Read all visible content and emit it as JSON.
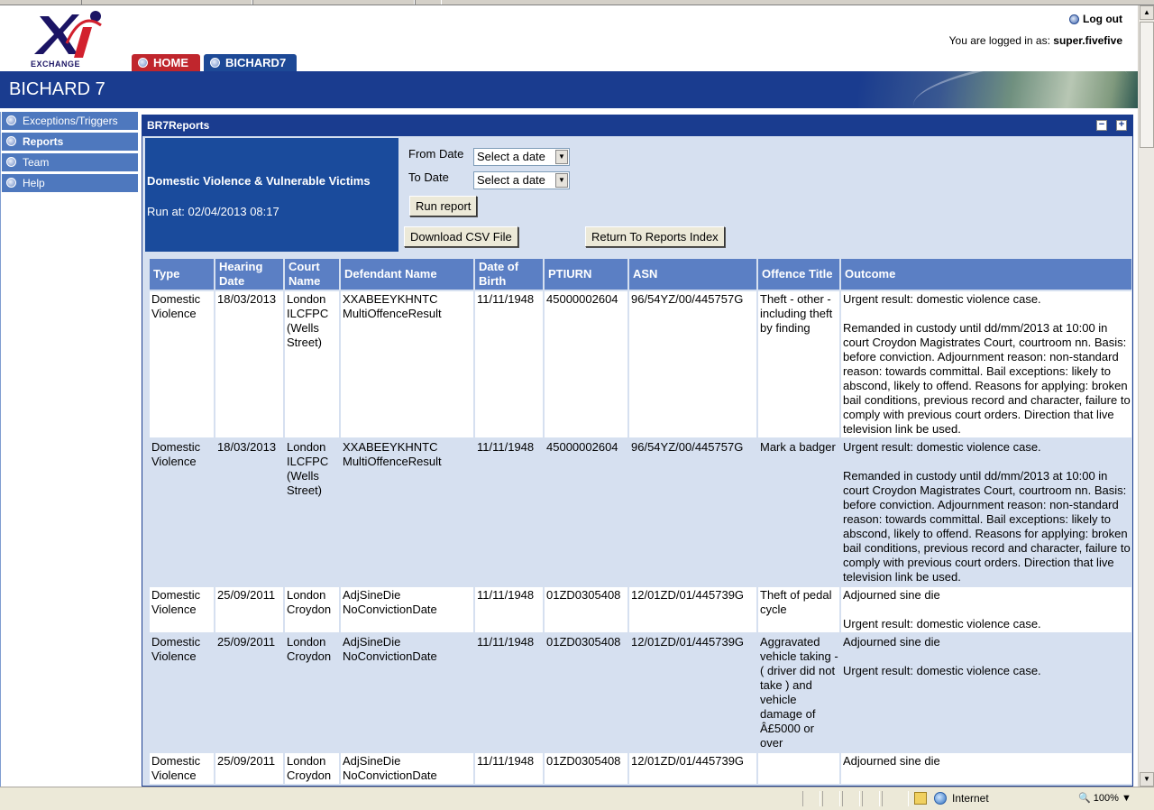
{
  "header": {
    "logo_text": "EXCHANGE",
    "logout_label": "Log out",
    "logged_in_prefix": "You are logged in as:",
    "username": "super.fivefive",
    "tabs": [
      {
        "label": "HOME"
      },
      {
        "label": "BICHARD7"
      }
    ],
    "banner_title": "BICHARD 7"
  },
  "sidebar": {
    "items": [
      {
        "label": "Exceptions/Triggers"
      },
      {
        "label": "Reports"
      },
      {
        "label": "Team"
      },
      {
        "label": "Help"
      }
    ]
  },
  "panel": {
    "title": "BR7Reports",
    "minimize_label": "−",
    "maximize_label": "+"
  },
  "report": {
    "name": "Domestic Violence & Vulnerable Victims",
    "run_at": "Run at: 02/04/2013 08:17",
    "from_label": "From Date",
    "to_label": "To Date",
    "from_value": "Select a date",
    "to_value": "Select a date",
    "run_button": "Run report",
    "csv_button": "Download CSV File",
    "return_button": "Return To Reports Index"
  },
  "table": {
    "headers": [
      "Type",
      "Hearing Date",
      "Court Name",
      "Defendant Name",
      "Date of Birth",
      "PTIURN",
      "ASN",
      "Offence Title",
      "Outcome"
    ],
    "rows": [
      {
        "type": "Domestic Violence",
        "hearing_date": "18/03/2013",
        "court": "London ILCFPC (Wells Street)",
        "defendant": "XXABEEYKHNTC MultiOffenceResult",
        "dob": "11/11/1948",
        "ptiurn": "45000002604",
        "asn": "96/54YZ/00/445757G",
        "offence": "Theft - other - including theft by finding",
        "outcome_1": "Urgent result: domestic violence case.",
        "outcome_2": "Remanded in custody until dd/mm/2013 at 10:00 in court Croydon Magistrates Court, courtroom nn. Basis: before conviction. Adjournment reason: non-standard reason: towards committal. Bail exceptions: likely to abscond, likely to offend. Reasons for applying: broken bail conditions, previous record and character, failure to comply with previous court orders. Direction that live television link be used."
      },
      {
        "type": "Domestic Violence",
        "hearing_date": "18/03/2013",
        "court": "London ILCFPC (Wells Street)",
        "defendant": "XXABEEYKHNTC MultiOffenceResult",
        "dob": "11/11/1948",
        "ptiurn": "45000002604",
        "asn": "96/54YZ/00/445757G",
        "offence": "Mark a badger",
        "outcome_1": "Urgent result: domestic violence case.",
        "outcome_2": "Remanded in custody until dd/mm/2013 at 10:00 in court Croydon Magistrates Court, courtroom nn. Basis: before conviction. Adjournment reason: non-standard reason: towards committal. Bail exceptions: likely to abscond, likely to offend. Reasons for applying: broken bail conditions, previous record and character, failure to comply with previous court orders. Direction that live television link be used."
      },
      {
        "type": "Domestic Violence",
        "hearing_date": "25/09/2011",
        "court": "London Croydon",
        "defendant": "AdjSineDie NoConvictionDate",
        "dob": "11/11/1948",
        "ptiurn": "01ZD0305408",
        "asn": "12/01ZD/01/445739G",
        "offence": "Theft of pedal cycle",
        "outcome_1": "Adjourned sine die",
        "outcome_2": "Urgent result: domestic violence case."
      },
      {
        "type": "Domestic Violence",
        "hearing_date": "25/09/2011",
        "court": "London Croydon",
        "defendant": "AdjSineDie NoConvictionDate",
        "dob": "11/11/1948",
        "ptiurn": "01ZD0305408",
        "asn": "12/01ZD/01/445739G",
        "offence": "Aggravated vehicle taking - ( driver did not take ) and vehicle damage of Â£5000 or over",
        "outcome_1": "Adjourned sine die",
        "outcome_2": "Urgent result: domestic violence case."
      },
      {
        "type": "Domestic Violence",
        "hearing_date": "25/09/2011",
        "court": "London Croydon",
        "defendant": "AdjSineDie NoConvictionDate",
        "dob": "11/11/1948",
        "ptiurn": "01ZD0305408",
        "asn": "12/01ZD/01/445739G",
        "offence": "",
        "outcome_1": "Adjourned sine die",
        "outcome_2": ""
      }
    ]
  },
  "statusbar": {
    "zone": "Internet",
    "zoom": "100%"
  }
}
